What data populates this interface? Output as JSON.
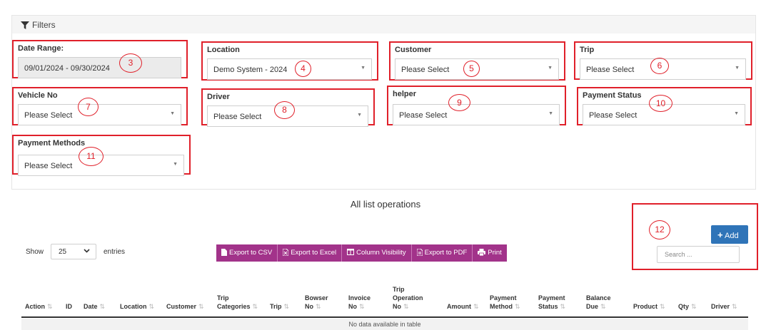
{
  "filters": {
    "title": "Filters",
    "date_range": {
      "label": "Date Range:",
      "value": "09/01/2024 - 09/30/2024",
      "marker": "3"
    },
    "location": {
      "label": "Location",
      "value": "Demo System - 2024",
      "marker": "4"
    },
    "customer": {
      "label": "Customer",
      "value": "Please Select",
      "marker": "5"
    },
    "trip": {
      "label": "Trip",
      "value": "Please Select",
      "marker": "6"
    },
    "vehicle_no": {
      "label": "Vehicle No",
      "value": "Please Select",
      "marker": "7"
    },
    "driver": {
      "label": "Driver",
      "value": "Please Select",
      "marker": "8"
    },
    "helper": {
      "label": "helper",
      "value": "Please Select",
      "marker": "9"
    },
    "payment_status": {
      "label": "Payment Status",
      "value": "Please Select",
      "marker": "10"
    },
    "payment_methods": {
      "label": "Payment Methods",
      "value": "Please Select",
      "marker": "11"
    }
  },
  "caption": "All list operations",
  "length": {
    "show": "Show",
    "value": "25",
    "entries": "entries"
  },
  "export_buttons": [
    "Export to CSV",
    "Export to Excel",
    "Column Visibility",
    "Export to PDF",
    "Print"
  ],
  "add": {
    "label": "Add",
    "marker": "12"
  },
  "search": {
    "placeholder": "Search ..."
  },
  "table": {
    "columns": [
      "Action",
      "ID",
      "Date",
      "Location",
      "Customer",
      "Trip\nCategories",
      "Trip",
      "Bowser\nNo",
      "Invoice\nNo",
      "Trip\nOperation\nNo",
      "Amount",
      "Payment\nMethod",
      "Payment\nStatus",
      "Balance\nDue",
      "Product",
      "Qty",
      "Driver"
    ],
    "empty_message": "No data available in table"
  },
  "colors": {
    "highlight": "#e0202a",
    "export_button": "#a2338a",
    "add_button": "#2f74b8"
  },
  "icons": [
    "filter-icon",
    "caret-down-icon",
    "file-icon",
    "excel-icon",
    "columns-icon",
    "pdf-icon",
    "printer-icon",
    "plus-icon",
    "sort-icon"
  ]
}
